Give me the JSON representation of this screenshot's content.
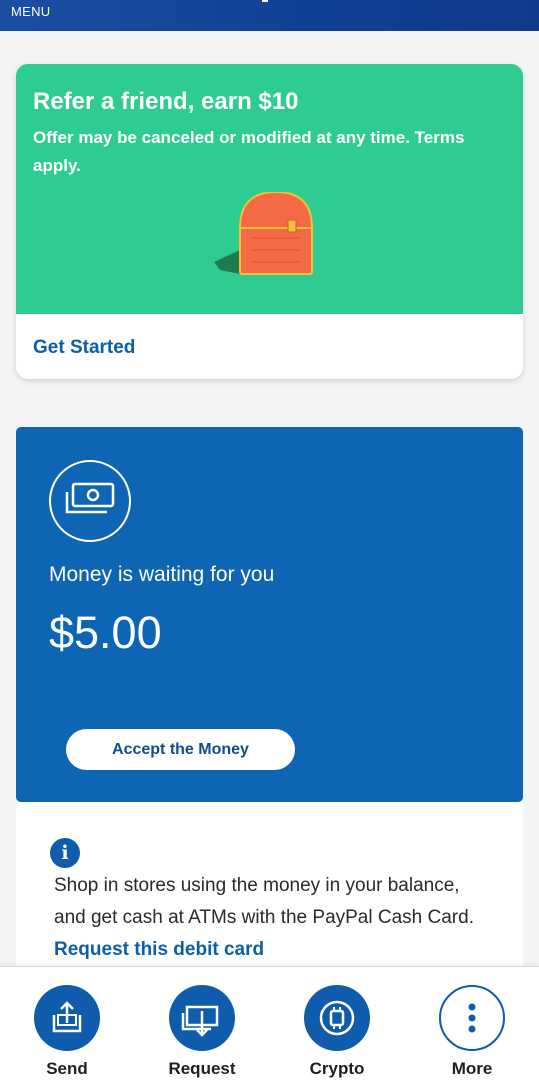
{
  "status_bar": {
    "menu_label": "MENU"
  },
  "refer_card": {
    "title": "Refer a friend, earn $10",
    "subtitle": "Offer may be canceled or modified at any time. Terms apply.",
    "cta_label": "Get Started",
    "illustration": "treasure-chest-icon",
    "accent_color": "#2ecc91"
  },
  "money_card": {
    "icon": "cash-icon",
    "title": "Money is waiting for you",
    "amount": "$5.00",
    "button_label": "Accept the Money",
    "background_color": "#0e65b4"
  },
  "info_section": {
    "icon": "info-icon",
    "text": "Shop in stores using the money in your balance, and get cash at ATMs with the PayPal Cash Card.",
    "link_label": "Request this debit card"
  },
  "bottom_nav": {
    "items": [
      {
        "label": "Send",
        "icon": "send-upload-icon"
      },
      {
        "label": "Request",
        "icon": "request-download-icon"
      },
      {
        "label": "Crypto",
        "icon": "crypto-chip-icon"
      },
      {
        "label": "More",
        "icon": "more-dots-icon"
      }
    ]
  }
}
